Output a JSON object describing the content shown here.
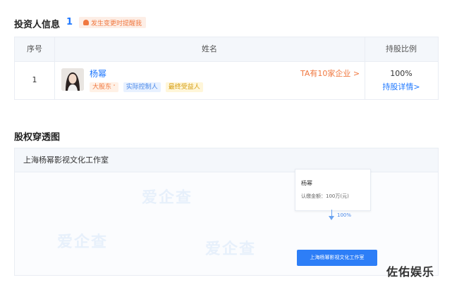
{
  "shareholder_section": {
    "title": "投资人信息",
    "count": "1",
    "remind_label": "发生变更时提醒我",
    "columns": {
      "index": "序号",
      "name": "姓名",
      "ratio": "持股比例"
    },
    "rows": [
      {
        "index": "1",
        "name": "杨幂",
        "tags": [
          "大股东",
          "实际控制人",
          "最终受益人"
        ],
        "company_count_link": "TA有10家企业 >",
        "ratio": "100%",
        "detail_link": "持股详情>"
      }
    ]
  },
  "penetration_section": {
    "title": "股权穿透图",
    "company": "上海杨幂影视文化工作室",
    "graph": {
      "shareholder_name": "杨幂",
      "subscribed_capital": "认缴金额：100万(元)",
      "edge_percent": "100%",
      "target_company": "上海杨幂影视文化工作室"
    },
    "watermark": "爱企查"
  },
  "footer_watermark": "佐佑娱乐",
  "colors": {
    "accent": "#1f78ff",
    "orange": "#f07840",
    "header_bg": "#f4f7fb",
    "node_blue": "#2d7ef7"
  }
}
